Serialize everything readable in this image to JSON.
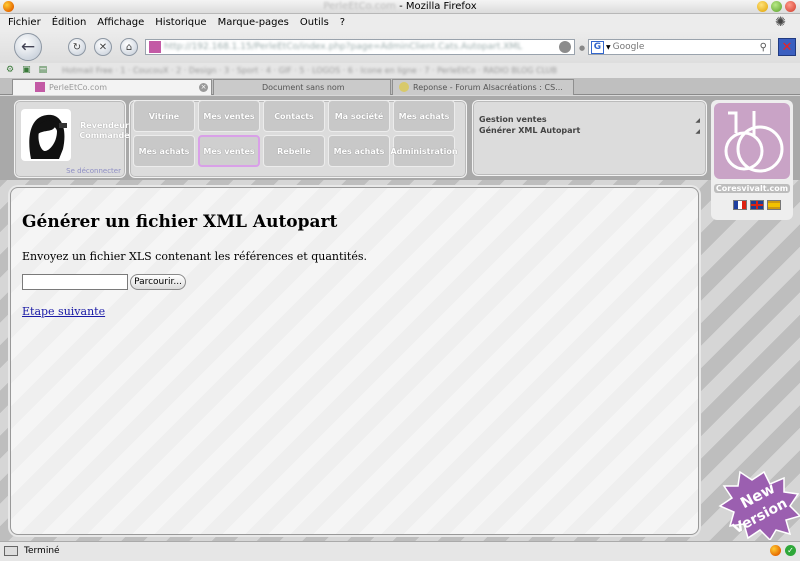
{
  "window": {
    "title_blur": "PerleEtCo.com",
    "title": " - Mozilla Firefox"
  },
  "menu": [
    "Fichier",
    "Édition",
    "Affichage",
    "Historique",
    "Marque-pages",
    "Outils",
    "?"
  ],
  "toolbar": {
    "url_blur": "http://192.168.1.15/PerleEtCo/index.php?page=AdminClient.Cats.Autopart.XML",
    "search_placeholder": "Google",
    "search_engine_letter": "G"
  },
  "bookmarks_blur": "Hotmail Free  ·  1 · CoucouX  ·  2 · Design  ·  3 · Sport  ·  4 · GIF  ·  5 · LOGOS  ·  6 · Icone en ligne  ·  7 · PerleEtCo  ·  RADIO BLOG CLUB",
  "tabs": [
    {
      "label": "PerleEtCo.com",
      "active": true
    },
    {
      "label": "Document sans nom",
      "active": false
    },
    {
      "label": "Reponse - Forum Alsacréations : CS...",
      "active": false
    }
  ],
  "user": {
    "role": "Revendeur Commande",
    "logout": "Se déconnecter"
  },
  "nav": {
    "row1": [
      "Vitrine",
      "Mes ventes",
      "Contacts",
      "Ma société",
      "Mes achats"
    ],
    "row2": [
      "Mes achats",
      "Mes ventes",
      "Rebelle",
      "Mes achats",
      "Administration"
    ]
  },
  "gestion": {
    "items": [
      "Gestion ventes",
      "Générer XML Autopart"
    ]
  },
  "brand": {
    "name": "Coresvivalt.com"
  },
  "page": {
    "title": "Générer un fichier XML Autopart",
    "description": "Envoyez un fichier XLS contenant les références et quantités.",
    "browse_label": "Parcourir...",
    "next_link": "Etape suivante"
  },
  "badge": {
    "line1": "New",
    "line2": "Version"
  },
  "status": {
    "text": "Terminé"
  },
  "colors": {
    "accent": "#d9a0e8",
    "link": "#1a1aa6",
    "logo": "#c9a3c6"
  }
}
